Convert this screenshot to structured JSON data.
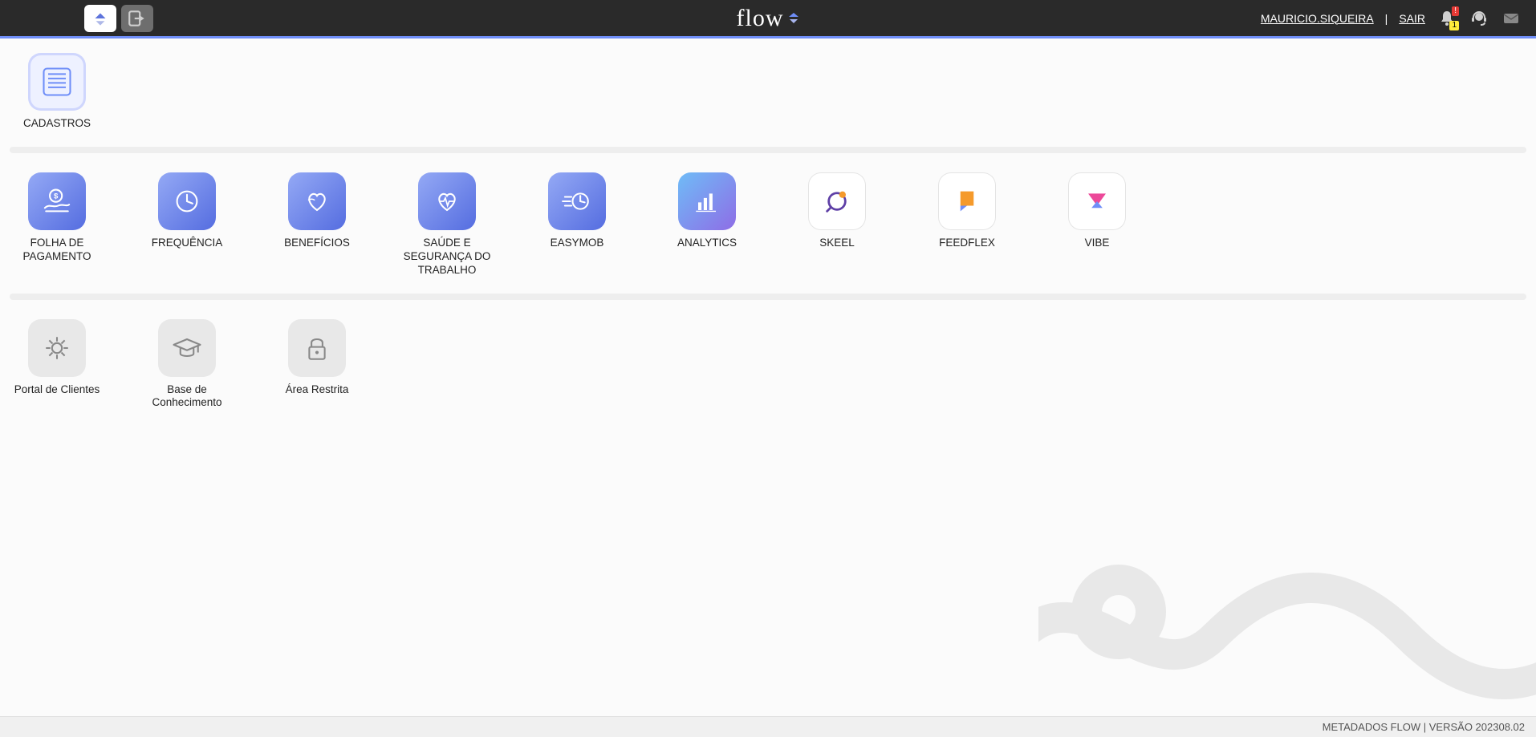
{
  "header": {
    "brand": "flow",
    "user": "MAURICIO.SIQUEIRA",
    "logout": "SAIR",
    "notif_top": "!",
    "notif_bottom": "1"
  },
  "sections": {
    "s1": [
      {
        "key": "cadastros",
        "label": "CADASTROS",
        "iconStyle": "framed",
        "icon": "list-lines"
      }
    ],
    "s2": [
      {
        "key": "folha",
        "label": "FOLHA DE PAGAMENTO",
        "iconStyle": "blue",
        "icon": "money-hand"
      },
      {
        "key": "frequencia",
        "label": "FREQUÊNCIA",
        "iconStyle": "blue",
        "icon": "clock"
      },
      {
        "key": "beneficios",
        "label": "BENEFÍCIOS",
        "iconStyle": "blue",
        "icon": "heart-care"
      },
      {
        "key": "saude",
        "label": "SAÚDE E SEGURANÇA DO TRABALHO",
        "iconStyle": "blue",
        "icon": "heart-pulse"
      },
      {
        "key": "easymob",
        "label": "EASYMOB",
        "iconStyle": "blue",
        "icon": "clock-motion"
      },
      {
        "key": "analytics",
        "label": "ANALYTICS",
        "iconStyle": "azure",
        "icon": "bar-chart"
      },
      {
        "key": "skeel",
        "label": "SKEEL",
        "iconStyle": "white",
        "icon": "skeel"
      },
      {
        "key": "feedflex",
        "label": "FEEDFLEX",
        "iconStyle": "white",
        "icon": "feedflex"
      },
      {
        "key": "vibe",
        "label": "VIBE",
        "iconStyle": "white",
        "icon": "vibe"
      }
    ],
    "s3": [
      {
        "key": "portal-clientes",
        "label": "Portal de Clientes",
        "iconStyle": "gray",
        "icon": "gear"
      },
      {
        "key": "base-conhecimento",
        "label": "Base de Conhecimento",
        "iconStyle": "gray",
        "icon": "grad-cap"
      },
      {
        "key": "area-restrita",
        "label": "Área Restrita",
        "iconStyle": "gray",
        "icon": "lock"
      }
    ]
  },
  "footer": {
    "text": "METADADOS FLOW | VERSÃO 202308.02"
  }
}
